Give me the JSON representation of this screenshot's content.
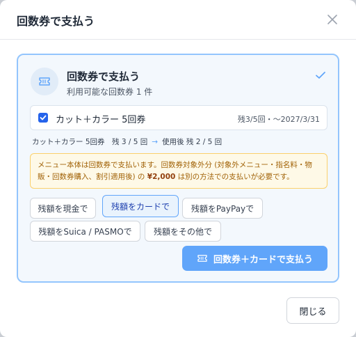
{
  "dialog": {
    "title": "回数券で支払う",
    "close_label": "閉じる"
  },
  "card": {
    "title": "回数券で支払う",
    "subtitle": "利用可能な回数券 1 件",
    "ticket": {
      "name": "カット＋カラー 5回券",
      "remaining": "残3/5回・〜2027/3/31",
      "checked": true
    },
    "usage": {
      "before": "カット＋カラー 5回券　残 3 / 5 回",
      "arrow": "→",
      "after": "使用後 残 2 / 5 回"
    },
    "notice": {
      "prefix": "メニュー本体は回数券で支払います。回数券対象外分 (対象外メニュー・指名料・物販・回数券購入、割引適用後) の ",
      "amount": "¥2,000",
      "suffix": " は別の方法での支払いが必要です。"
    },
    "payment_options": [
      {
        "label": "残額を現金で",
        "selected": false
      },
      {
        "label": "残額をカードで",
        "selected": true
      },
      {
        "label": "残額をPayPayで",
        "selected": false
      },
      {
        "label": "残額をSuica / PASMOで",
        "selected": false
      },
      {
        "label": "残額をその他で",
        "selected": false
      }
    ],
    "submit_label": "回数券＋カードで支払う"
  },
  "icons": {
    "close": "close-icon",
    "ticket": "ticket-icon",
    "check": "check-icon",
    "checkbox": "checkbox-checked-icon"
  },
  "colors": {
    "accent": "#60a5fa",
    "checkbox": "#2563eb",
    "card_border": "#93c5fd",
    "notice_bg": "#fef9e7",
    "notice_text": "#a16207"
  }
}
